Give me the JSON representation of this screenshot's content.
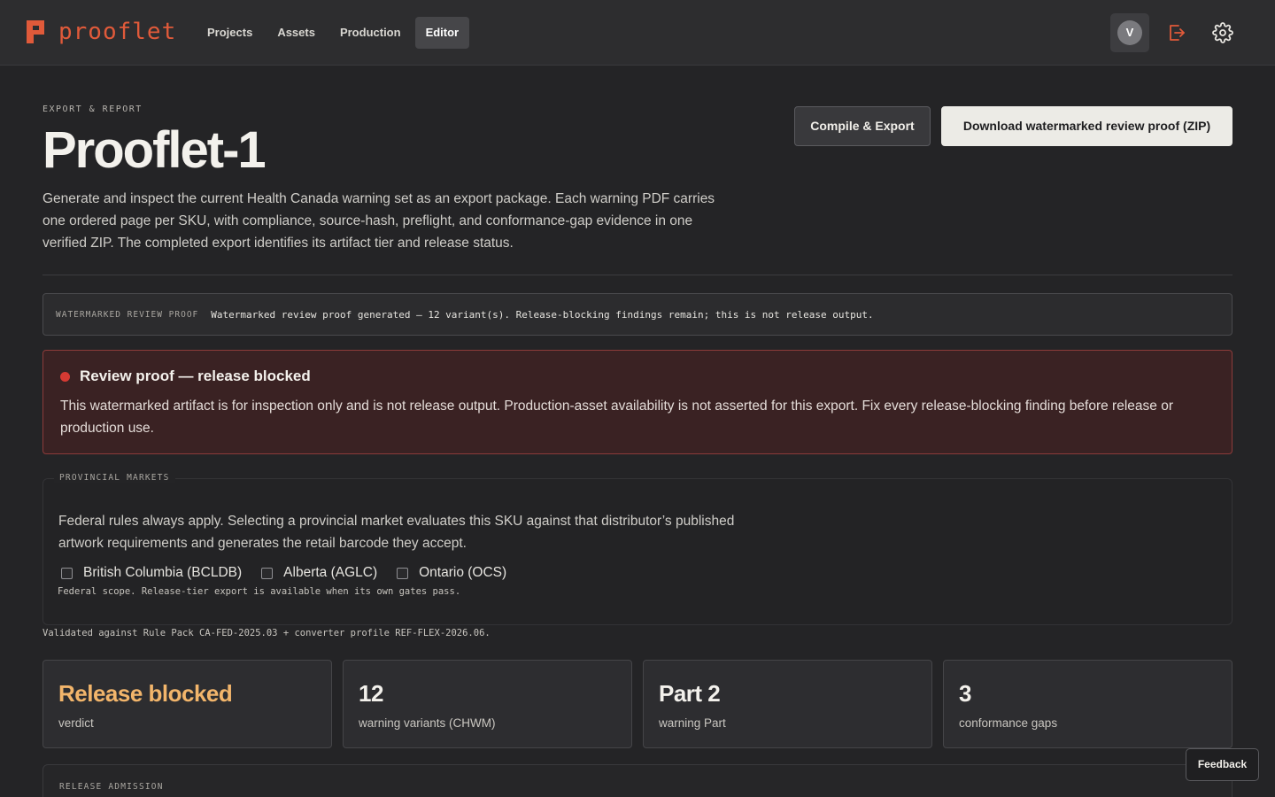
{
  "brand": {
    "name": "prooflet",
    "accent": "#e05a3a"
  },
  "nav": {
    "items": [
      {
        "label": "Projects"
      },
      {
        "label": "Assets"
      },
      {
        "label": "Production"
      },
      {
        "label": "Editor",
        "active": true
      }
    ]
  },
  "user": {
    "initial": "V"
  },
  "header": {
    "eyebrow": "EXPORT & REPORT",
    "title": "Prooflet-1",
    "intro": "Generate and inspect the current Health Canada warning set as an export package. Each warning PDF carries one ordered page per SKU, with compliance, source-hash, preflight, and conformance-gap evidence in one verified ZIP. The completed export identifies its artifact tier and release status."
  },
  "actions": {
    "compile_label": "Compile & Export",
    "download_label": "Download watermarked review proof (ZIP)"
  },
  "proof_banner": {
    "tag": "WATERMARKED REVIEW PROOF",
    "message": "Watermarked review proof generated — 12 variant(s). Release-blocking findings remain; this is not release output."
  },
  "alert": {
    "title": "Review proof — release blocked",
    "body": "This watermarked artifact is for inspection only and is not release output. Production-asset availability is not asserted for this export. Fix every release-blocking finding before release or production use.",
    "color": "#d63a33"
  },
  "provincial": {
    "legend": "PROVINCIAL MARKETS",
    "description": "Federal rules always apply. Selecting a provincial market evaluates this SKU against that distributor’s published artwork requirements and generates the retail barcode they accept.",
    "options": [
      {
        "label": "British Columbia (BCLDB)",
        "checked": false
      },
      {
        "label": "Alberta (AGLC)",
        "checked": false
      },
      {
        "label": "Ontario (OCS)",
        "checked": false
      }
    ],
    "note": "Federal scope. Release-tier export is available when its own gates pass."
  },
  "rulepack": "Validated against Rule Pack CA-FED-2025.03 + converter profile REF-FLEX-2026.06.",
  "stats": [
    {
      "value": "Release blocked",
      "label": "verdict",
      "color": "#f2b56b"
    },
    {
      "value": "12",
      "label": "warning variants (CHWM)"
    },
    {
      "value": "Part 2",
      "label": "warning Part"
    },
    {
      "value": "3",
      "label": "conformance gaps"
    }
  ],
  "admission": {
    "legend": "RELEASE ADMISSION"
  },
  "feedback_label": "Feedback"
}
